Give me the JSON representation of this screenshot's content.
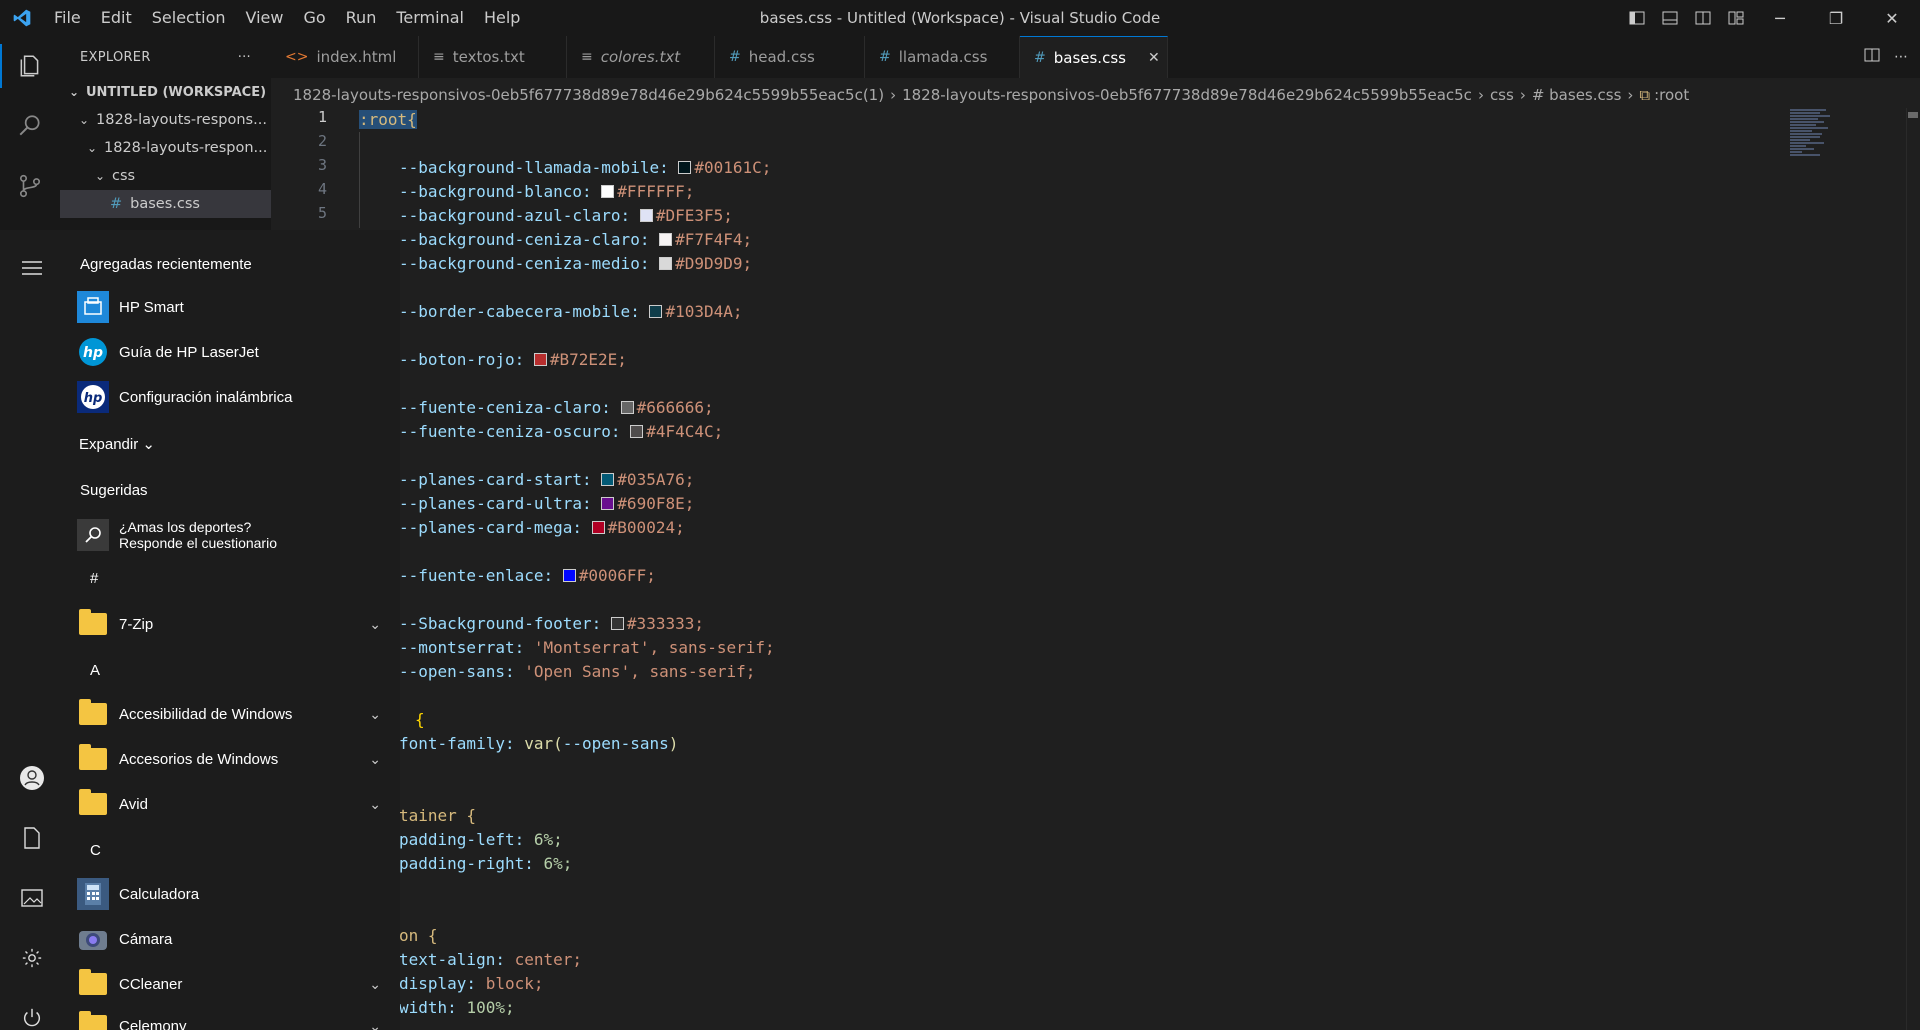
{
  "window": {
    "title": "bases.css - Untitled (Workspace) - Visual Studio Code",
    "menu": [
      "File",
      "Edit",
      "Selection",
      "View",
      "Go",
      "Run",
      "Terminal",
      "Help"
    ]
  },
  "explorer": {
    "header": "EXPLORER",
    "more": "···",
    "workspace": "UNTITLED (WORKSPACE)",
    "items": [
      {
        "label": "1828-layouts-respons..."
      },
      {
        "label": "1828-layouts-respon..."
      },
      {
        "label": "css"
      },
      {
        "label": "bases.css"
      }
    ]
  },
  "tabs": [
    {
      "label": "index.html",
      "icon": "<>"
    },
    {
      "label": "textos.txt",
      "icon": "≡"
    },
    {
      "label": "colores.txt",
      "icon": "≡"
    },
    {
      "label": "head.css",
      "icon": "#"
    },
    {
      "label": "llamada.css",
      "icon": "#"
    },
    {
      "label": "bases.css",
      "icon": "#"
    }
  ],
  "breadcrumb": [
    "1828-layouts-responsivos-0eb5f677738d89e78d46e29b624c5599b55eac5c(1)",
    "1828-layouts-responsivos-0eb5f677738d89e78d46e29b624c5599b55eac5c",
    "css",
    "# bases.css",
    ":root"
  ],
  "line_numbers": [
    "1",
    "2",
    "3",
    "4",
    "5"
  ],
  "code": {
    "root": ":root{",
    "vars": [
      {
        "name": "--background-llamada-mobile: ",
        "color": "#00161C",
        "value": "#00161C;"
      },
      {
        "name": "--background-blanco: ",
        "color": "#FFFFFF",
        "value": "#FFFFFF;"
      },
      {
        "name": "--background-azul-claro: ",
        "color": "#DFE3F5",
        "value": "#DFE3F5;"
      },
      {
        "name": "--background-ceniza-claro: ",
        "color": "#F7F4F4",
        "value": "#F7F4F4;"
      },
      {
        "name": "--background-ceniza-medio: ",
        "color": "#D9D9D9",
        "value": "#D9D9D9;"
      },
      {
        "name": "--border-cabecera-mobile: ",
        "color": "#103D4A",
        "value": "#103D4A;"
      },
      {
        "name": "--boton-rojo: ",
        "color": "#B72E2E",
        "value": "#B72E2E;"
      },
      {
        "name": "--fuente-ceniza-claro: ",
        "color": "#666666",
        "value": "#666666;"
      },
      {
        "name": "--fuente-ceniza-oscuro: ",
        "color": "#4F4C4C",
        "value": "#4F4C4C;"
      },
      {
        "name": "--planes-card-start: ",
        "color": "#035A76",
        "value": "#035A76;"
      },
      {
        "name": "--planes-card-ultra: ",
        "color": "#690F8E",
        "value": "#690F8E;"
      },
      {
        "name": "--planes-card-mega: ",
        "color": "#B00024",
        "value": "#B00024;"
      },
      {
        "name": "--fuente-enlace: ",
        "color": "#0006FF",
        "value": "#0006FF;"
      },
      {
        "name": "--Sbackground-footer: ",
        "color": "#333333",
        "value": "#333333;"
      }
    ],
    "montserrat": {
      "name": "--montserrat: ",
      "str": "'Montserrat'",
      "rest": ", sans-serif;"
    },
    "opensans": {
      "name": "--open-sans: ",
      "str": "'Open Sans'",
      "rest": ", sans-serif;"
    },
    "brace1": "{",
    "font_family": {
      "prop": "font-family: ",
      "fn": "var(",
      "arg": "--open-sans",
      ")": ")"
    },
    "container": "tainer {",
    "padding_left": {
      "prop": "padding-left: ",
      "val": "6%;"
    },
    "padding_right": {
      "prop": "padding-right: ",
      "val": "6%;"
    },
    "button": "on {",
    "text_align": {
      "prop": "text-align: ",
      "val": "center;"
    },
    "display": {
      "prop": "display: ",
      "val": "block;"
    },
    "width": {
      "prop": "width: ",
      "val": "100%;"
    }
  },
  "start_menu": {
    "recent_title": "Agregadas recientemente",
    "recent": [
      "HP Smart",
      "Guía de HP LaserJet",
      "Configuración inalámbrica"
    ],
    "expand": "Expandir",
    "suggested_title": "Sugeridas",
    "suggestion_line1": "¿Amas los deportes?",
    "suggestion_line2": "Responde el cuestionario",
    "letter_hash": "#",
    "app_7zip": "7-Zip",
    "letter_a": "A",
    "app_acc": "Accesibilidad de Windows",
    "app_accesorios": "Accesorios de Windows",
    "app_avid": "Avid",
    "letter_c": "C",
    "app_calc": "Calculadora",
    "app_camara": "Cámara",
    "app_ccleaner": "CCleaner",
    "app_celemony": "Celemony"
  },
  "colors": {
    "accent": "#0078d4",
    "keyword": "#dcdcaa",
    "property": "#9cdcfe",
    "string": "#ce9178",
    "value": "#ce9178"
  }
}
